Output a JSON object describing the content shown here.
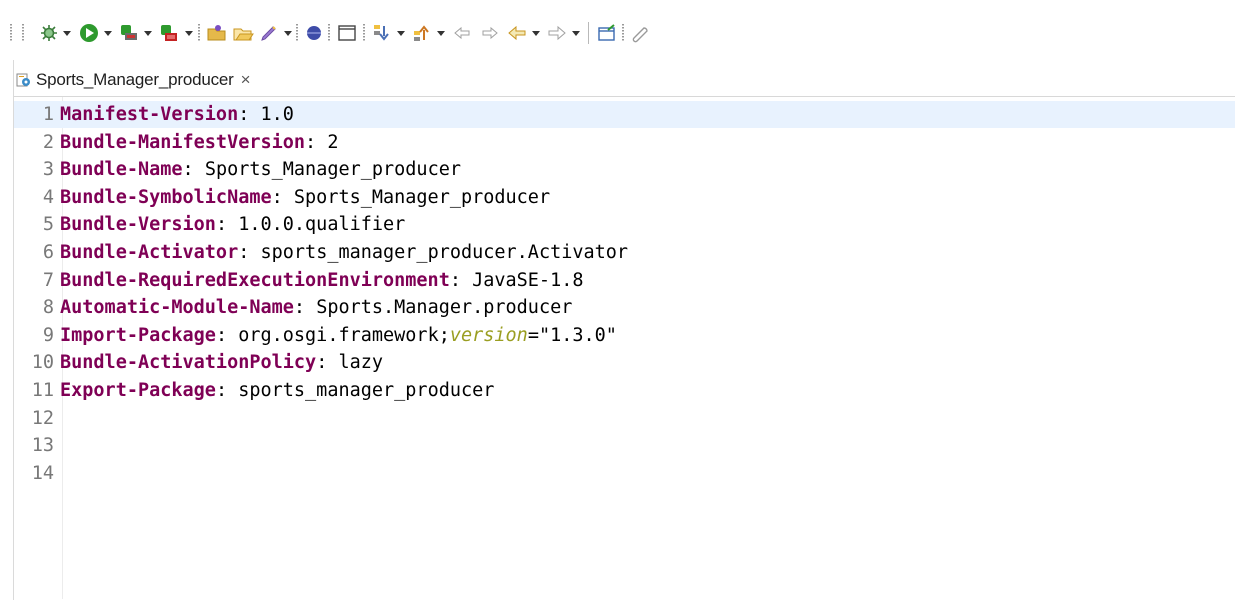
{
  "toolbar": {
    "icons": [
      "debug-icon",
      "run-icon",
      "run-external-icon",
      "run-coverage-icon",
      "open-folder-icon",
      "open-folder-outline-icon",
      "pen-icon",
      "breakpoint-icon",
      "window-icon",
      "next-annotation-icon",
      "previous-annotation-icon",
      "back-edit-icon",
      "forward-edit-icon",
      "back-icon",
      "forward-icon",
      "open-console-icon",
      "link-icon"
    ]
  },
  "editor": {
    "tab_title": "Sports_Manager_producer",
    "tab_close": "×",
    "lines": [
      {
        "num": "1",
        "key": "Manifest-Version",
        "sep": ": ",
        "value": "1.0"
      },
      {
        "num": "2",
        "key": "Bundle-ManifestVersion",
        "sep": ": ",
        "value": "2"
      },
      {
        "num": "3",
        "key": "Bundle-Name",
        "sep": ": ",
        "value": "Sports_Manager_producer"
      },
      {
        "num": "4",
        "key": "Bundle-SymbolicName",
        "sep": ": ",
        "value": "Sports_Manager_producer"
      },
      {
        "num": "5",
        "key": "Bundle-Version",
        "sep": ": ",
        "value": "1.0.0.qualifier"
      },
      {
        "num": "6",
        "key": "Bundle-Activator",
        "sep": ": ",
        "value": "sports_manager_producer.Activator"
      },
      {
        "num": "7",
        "key": "Bundle-RequiredExecutionEnvironment",
        "sep": ": ",
        "value": "JavaSE-1.8"
      },
      {
        "num": "8",
        "key": "Automatic-Module-Name",
        "sep": ": ",
        "value": "Sports.Manager.producer"
      },
      {
        "num": "9",
        "key": "Import-Package",
        "sep": ": ",
        "value": "org.osgi.framework;",
        "attr": "version",
        "attr_value": "=\"1.3.0\""
      },
      {
        "num": "10",
        "key": "Bundle-ActivationPolicy",
        "sep": ": ",
        "value": "lazy"
      },
      {
        "num": "11",
        "key": "Export-Package",
        "sep": ": ",
        "value": "sports_manager_producer"
      },
      {
        "num": "12",
        "key": "",
        "sep": "",
        "value": ""
      },
      {
        "num": "13",
        "key": "",
        "sep": "",
        "value": ""
      },
      {
        "num": "14",
        "key": "",
        "sep": "",
        "value": ""
      }
    ]
  }
}
